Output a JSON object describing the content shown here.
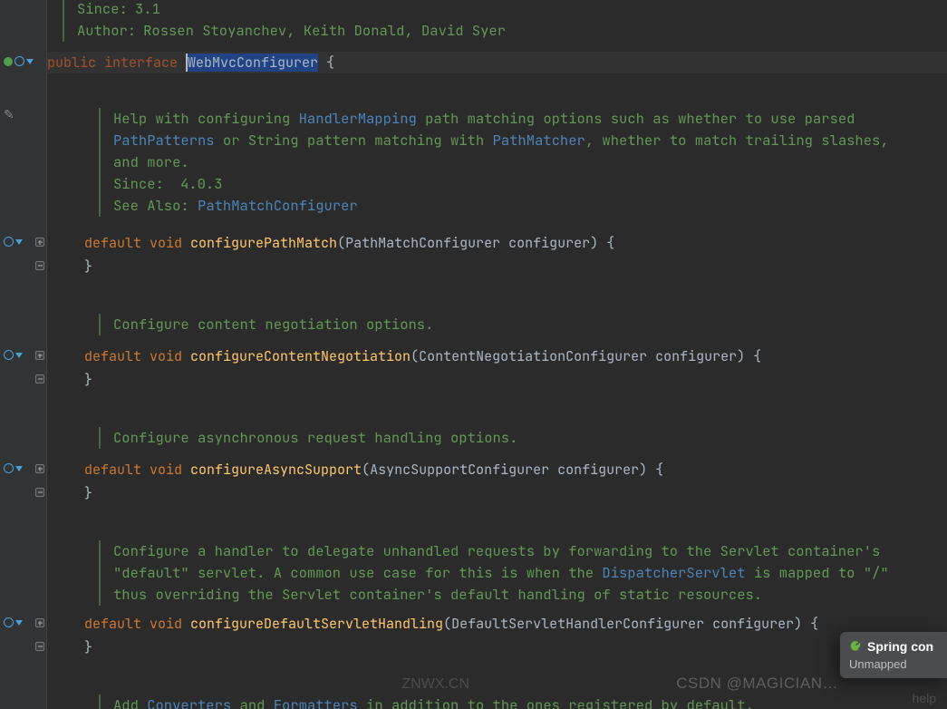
{
  "header": {
    "since_label": "Since:",
    "since_value": "3.1",
    "author_label": "Author:",
    "author_value": "Rossen Stoyanchev, Keith Donald, David Syer"
  },
  "decl": {
    "public_kw": "public ",
    "interface_kw": "interface ",
    "name": "WebMvcConfigurer",
    "brace": " {"
  },
  "m1": {
    "doc1a": "Help with configuring ",
    "doc1b": "HandlerMapping",
    "doc1c": " path matching options such as whether to use parsed ",
    "doc2a": "PathPatterns",
    "doc2b": " or String pattern matching with ",
    "doc2c": "PathMatcher",
    "doc2d": ", whether to match trailing slashes, ",
    "doc3": "and more.",
    "since_label": "Since:",
    "since_value": "4.0.3",
    "see_label": "See Also: ",
    "see_value": "PathMatchConfigurer",
    "default_kw": "default ",
    "void_kw": "void ",
    "fn": "configurePathMatch",
    "param_type": "PathMatchConfigurer",
    "param_name": " configurer",
    "sig_open": "(",
    "sig_close": ") {",
    "close": "}"
  },
  "m2": {
    "doc": "Configure content negotiation options.",
    "default_kw": "default ",
    "void_kw": "void ",
    "fn": "configureContentNegotiation",
    "param_type": "ContentNegotiationConfigurer",
    "param_name": " configurer",
    "sig_open": "(",
    "sig_close": ") {",
    "close": "}"
  },
  "m3": {
    "doc": "Configure asynchronous request handling options.",
    "default_kw": "default ",
    "void_kw": "void ",
    "fn": "configureAsyncSupport",
    "param_type": "AsyncSupportConfigurer",
    "param_name": " configurer",
    "sig_open": "(",
    "sig_close": ") {",
    "close": "}"
  },
  "m4": {
    "doc1": "Configure a handler to delegate unhandled requests by forwarding to the Servlet container's ",
    "doc2a": "\"default\" servlet. A common use case for this is when the ",
    "doc2b": "DispatcherServlet",
    "doc2c": " is mapped to \"/\" ",
    "doc3": "thus overriding the Servlet container's default handling of static resources.",
    "default_kw": "default ",
    "void_kw": "void ",
    "fn": "configureDefaultServletHandling",
    "param_type": "DefaultServletHandlerConfigurer",
    "param_name": " configurer",
    "sig_open": "(",
    "sig_close": ") {",
    "close": "}"
  },
  "m5": {
    "doc1a": "Add ",
    "doc1b": "Converters",
    "doc1c": " and ",
    "doc1d": "Formatters",
    "doc1e": " in addition to the ones registered by default."
  },
  "watermark1": "CSDN @MAGICIAN…",
  "watermark2": "ZNWX.CN",
  "watermark3": "help",
  "popup": {
    "title": "Spring con",
    "sub": "Unmapped"
  }
}
